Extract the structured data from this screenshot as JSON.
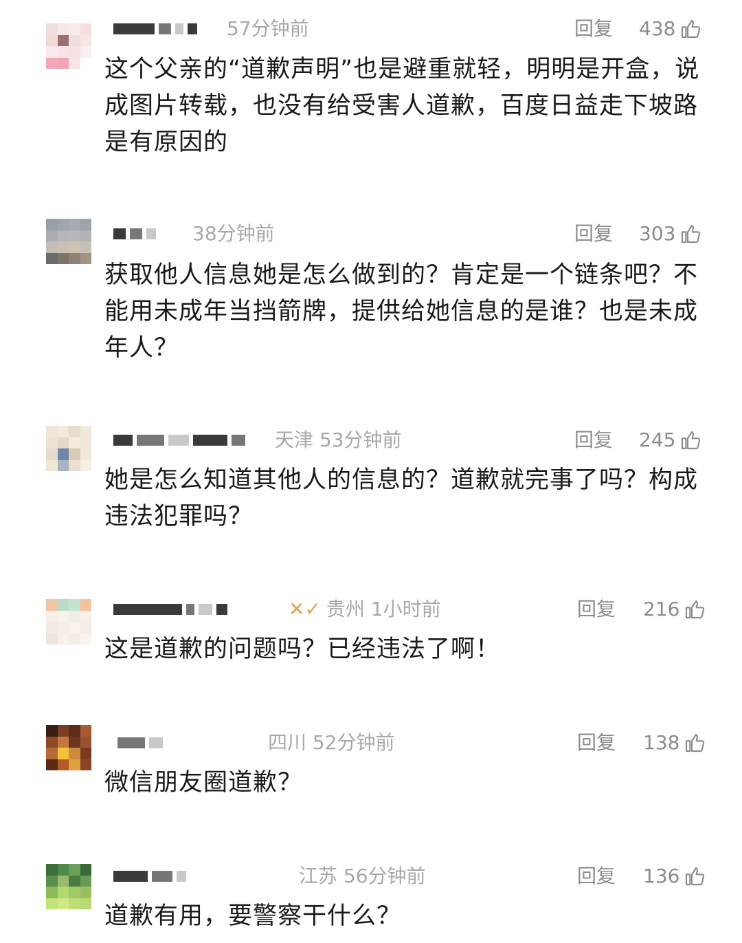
{
  "comments": [
    {
      "meta": "57分钟前",
      "region": "",
      "reply_label": "回复",
      "likes": "438",
      "text": "这个父亲的“道歉声明”也是避重就轻，明明是开盒，说成图片转载，也没有给受害人道歉，百度日益走下坡路是有原因的",
      "avatar_colors": [
        "#f3dede",
        "#f7e8e8",
        "#fbeaea",
        "#f5dede",
        "#f4d9d9",
        "#9a7070",
        "#f0dede",
        "#f7e6e6",
        "#fae9ea",
        "#f8e4e4",
        "#f6e2e2",
        "#fbeeee",
        "#f2a8b8",
        "#f2a2b2",
        "#f6e4e6",
        "#fff"
      ]
    },
    {
      "meta": "38分钟前",
      "region": "",
      "reply_label": "回复",
      "likes": "303",
      "text": "获取他人信息她是怎么做到的？肯定是一个链条吧？不能用未成年当挡箭牌，提供给她信息的是谁？也是未成年人？",
      "avatar_colors": [
        "#9aa0a8",
        "#a0a6ae",
        "#a5abb3",
        "#9ea4ac",
        "#a9adb3",
        "#b4b6b8",
        "#b9b9ba",
        "#b2b4b6",
        "#c3bfb8",
        "#c9c1b4",
        "#cdc3b3",
        "#c5bfb6",
        "#6a6a6a",
        "#7a746c",
        "#8c8276",
        "#a09484"
      ]
    },
    {
      "meta": "53分钟前",
      "region": "天津",
      "reply_label": "回复",
      "likes": "245",
      "text": "她是怎么知道其他人的信息的？道歉就完事了吗？构成违法犯罪吗？",
      "avatar_colors": [
        "#efe6d8",
        "#f2eadc",
        "#e9dccb",
        "#f0e8da",
        "#ece3d4",
        "#e2d9c9",
        "#f4ecdf",
        "#efe7d9",
        "#e6dccc",
        "#6f86a8",
        "#d8ccb6",
        "#efe7d8",
        "#efe6d6",
        "#aab4c0",
        "#e9dfcf",
        "#f6efe4"
      ]
    },
    {
      "meta": "1小时前",
      "region": "贵州",
      "reply_label": "回复",
      "likes": "216",
      "vip": "✕✓",
      "text": "这是道歉的问题吗？已经违法了啊！",
      "avatar_colors": [
        "#f2c6a4",
        "#b9dcc4",
        "#c6e3d0",
        "#f4c29e",
        "#f5efe8",
        "#f7f2ec",
        "#f2ece6",
        "#f6f0ea",
        "#f3ece6",
        "#f5eee8",
        "#f8f3ee",
        "#f4eee8",
        "#efe5dc",
        "#f7f1ea",
        "#f4ede6",
        "#f9f4ef"
      ]
    },
    {
      "meta": "52分钟前",
      "region": "四川",
      "reply_label": "回复",
      "likes": "138",
      "text": "微信朋友圈道歉？",
      "avatar_colors": [
        "#3b1d12",
        "#7a3e22",
        "#5c2c18",
        "#a85a30",
        "#8c4a26",
        "#c4783e",
        "#6e3620",
        "#9a5230",
        "#b86a34",
        "#f2c23a",
        "#d08a3c",
        "#7a3a20",
        "#5a2a16",
        "#b4582a",
        "#e0a040",
        "#8a4624"
      ]
    },
    {
      "meta": "56分钟前",
      "region": "江苏",
      "reply_label": "回复",
      "likes": "136",
      "text": "道歉有用，要警察干什么？",
      "avatar_colors": [
        "#3c6e3a",
        "#4f8a46",
        "#6aa05a",
        "#3a6a38",
        "#5a8e4c",
        "#9ab86c",
        "#4a7c42",
        "#6a9c56",
        "#8cbc5a",
        "#b4d870",
        "#a0c864",
        "#98c05e",
        "#c4e27a",
        "#d0e888",
        "#c0de78",
        "#b8d872"
      ]
    }
  ]
}
